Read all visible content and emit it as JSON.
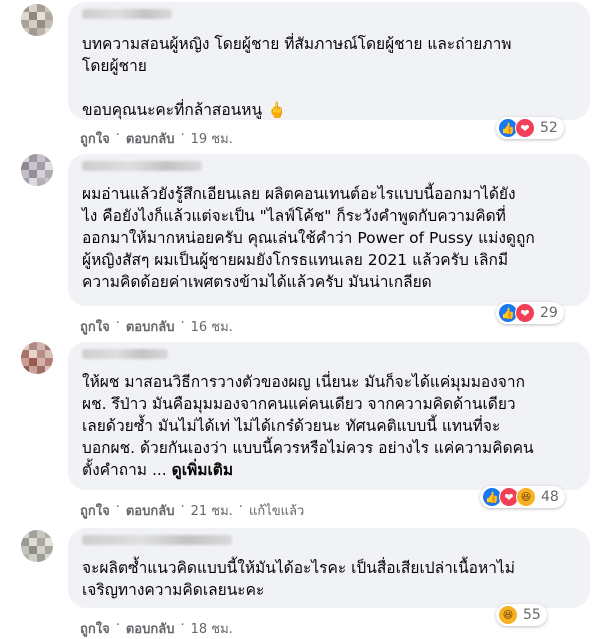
{
  "colors": {
    "bubble": "#f0f2f5",
    "meta": "#65676b",
    "like": "#1877f2",
    "love": "#f33e58",
    "haha": "#f7b125"
  },
  "icons": {
    "like": "thumbs-up-icon",
    "love": "heart-icon",
    "haha": "laughing-face-icon"
  },
  "comments": [
    {
      "lines": [
        "บทความสอนผู้หญิง โดยผู้ชาย ที่สัมภาษณ์โดยผู้ชาย และถ่ายภาพ",
        "โดยผู้ชาย",
        "",
        "ขอบคุณนะคะที่กล้าสอนหนู 🖕"
      ],
      "like": "ถูกใจ",
      "reply": "ตอบกลับ",
      "time": "19 ชม.",
      "count": "52"
    },
    {
      "lines": [
        "ผมอ่านแล้วยังรู้สึกเอียนเลย ผลิตคอนเทนต์อะไรแบบนี้ออกมาได้ยัง",
        "ไง คือยังไงก็แล้วแต่จะเป็น \"ไลฟ์โค้ช\" ก็ระวังคำพูดกับความคิดที่",
        "ออกมาให้มากหน่อยครับ คุณเล่นใช้คำว่า Power of Pussy แม่งดูถูก",
        "ผู้หญิงสัสๆ ผมเป็นผู้ชายผมยังโกรธแทนเลย 2021 แล้วครับ เลิกมี",
        "ความคิดด้อยค่าเพศตรงข้ามได้แล้วครับ มันน่าเกลียด"
      ],
      "like": "ถูกใจ",
      "reply": "ตอบกลับ",
      "time": "16 ชม.",
      "count": "29"
    },
    {
      "lines": [
        "ให้ผช มาสอนวิธีการวางตัวของผญ เนี่ยนะ มันก็จะได้แค่มุมมองจาก",
        "ผช. รึป่าว มันคือมุมมองจากคนแค่คนเดียว จากความคิดด้านเดียว",
        "เลยด้วยซ้ำ มันไม่ได้เท่ ไม่ได้เกร๋ด้วยนะ ทัศนคติแบบนี้ แทนที่จะ",
        "บอกผช. ด้วยกันเองว่า แบบนี้ควรหรือไม่ควร อย่างไร แค่ความคิดคน",
        "ตั้งคำถาม ... "
      ],
      "see_more": "ดูเพิ่มเติม",
      "like": "ถูกใจ",
      "reply": "ตอบกลับ",
      "time": "21 ชม.",
      "edited": "แก้ไขแล้ว",
      "count": "48"
    },
    {
      "lines": [
        "จะผลิตซ้ำแนวคิดแบบนี้ให้มันได้อะไรคะ เป็นสื่อเสียเปล่าเนื้อหาไม่",
        "เจริญทางความคิดเลยนะคะ"
      ],
      "like": "ถูกใจ",
      "reply": "ตอบกลับ",
      "time": "18 ชม.",
      "count": "55"
    }
  ],
  "separator": "·"
}
